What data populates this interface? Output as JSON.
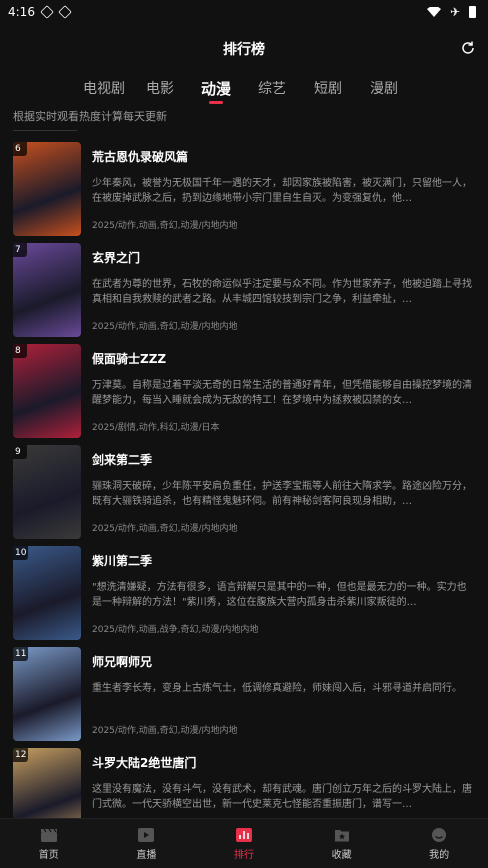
{
  "status": {
    "time": "4:16"
  },
  "header": {
    "title": "排行榜"
  },
  "tabs": [
    {
      "label": "电视剧"
    },
    {
      "label": "电影"
    },
    {
      "label": "动漫"
    },
    {
      "label": "综艺"
    },
    {
      "label": "短剧"
    },
    {
      "label": "漫剧"
    }
  ],
  "active_tab": "动漫",
  "subtitle": "根据实时观看热度计算每天更新",
  "items": [
    {
      "rank": "6",
      "title": "荒古恩仇录破风篇",
      "desc": "少年秦风，被誉为无极国千年一遇的天才，却因家族被陷害，被灭满门，只留他一人，在被废掉武脉之后，扔到边缘地带小宗门里自生自灭。为变强复仇，他…",
      "meta": "2025/动作,动画,奇幻,动漫/内地内地",
      "color": "#c8501e"
    },
    {
      "rank": "7",
      "title": "玄界之门",
      "desc": "在武者为尊的世界，石牧的命运似乎注定要与众不同。作为世家养子，他被迫踏上寻找真相和自我救赎的武者之路。从丰城四馆较技到宗门之争，利益牵扯，…",
      "meta": "2025/动作,动画,奇幻,动漫/内地内地",
      "color": "#6a4a9a"
    },
    {
      "rank": "8",
      "title": "假面骑士ZZZ",
      "desc": "万津莫。自称是过着平淡无奇的日常生活的普通好青年，但凭借能够自由操控梦境的清醒梦能力，每当入睡就会成为无敌的特工！在梦境中为拯救被囚禁的女…",
      "meta": "2025/剧情,动作,科幻,动漫/日本",
      "color": "#b0203a"
    },
    {
      "rank": "9",
      "title": "剑来第二季",
      "desc": "骊珠洞天破碎，少年陈平安肩负重任，护送李宝瓶等人前往大隋求学。路途凶险万分，既有大骊铁骑追杀，也有精怪鬼魅环伺。前有神秘剑客阿良现身相助，…",
      "meta": "2025/动作,动画,奇幻,动漫/内地内地",
      "color": "#3a3a3a"
    },
    {
      "rank": "10",
      "title": "紫川第二季",
      "desc": "\"想洗清嫌疑，方法有很多，语言辩解只是其中的一种，但也是最无力的一种。实力也是一种辩解的方法！\"紫川秀，这位在腹族大营内孤身击杀紫川家叛徒的…",
      "meta": "2025/动作,动画,战争,奇幻,动漫/内地内地",
      "color": "#3a5a8a"
    },
    {
      "rank": "11",
      "title": "师兄啊师兄",
      "desc": "重生者李长寿，变身上古炼气士，低调修真避险，师妹闯入后，斗邪寻道并启同行。",
      "meta": "2025/动作,动画,奇幻,动漫/内地内地",
      "color": "#7a9ac8"
    },
    {
      "rank": "12",
      "title": "斗罗大陆2绝世唐门",
      "desc": "这里没有魔法，没有斗气，没有武术，却有武魂。唐门创立万年之后的斗罗大陆上，唐门式微。一代天骄横空出世，新一代史莱克七怪能否重振唐门，谱写一…",
      "meta": "",
      "color": "#c8a060"
    }
  ],
  "nav": [
    {
      "label": "首页",
      "icon": "clapperboard-icon"
    },
    {
      "label": "直播",
      "icon": "play-icon"
    },
    {
      "label": "排行",
      "icon": "chart-icon"
    },
    {
      "label": "收藏",
      "icon": "bookmark-icon"
    },
    {
      "label": "我的",
      "icon": "profile-icon"
    }
  ],
  "active_nav": "排行"
}
